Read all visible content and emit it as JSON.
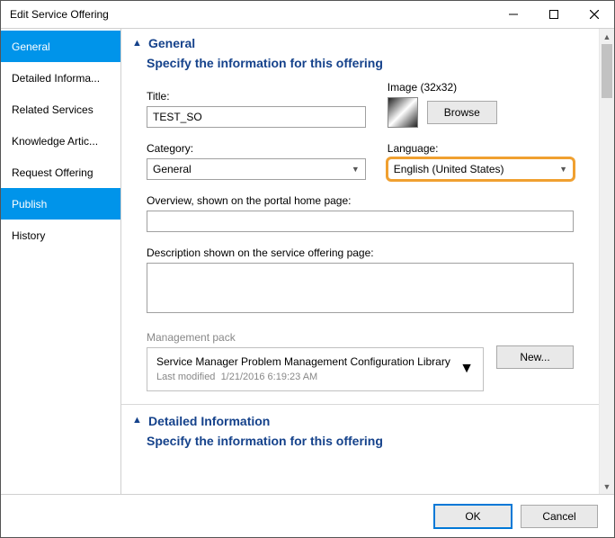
{
  "window": {
    "title": "Edit Service Offering"
  },
  "sidebar": {
    "items": [
      {
        "label": "General"
      },
      {
        "label": "Detailed Informa..."
      },
      {
        "label": "Related Services"
      },
      {
        "label": "Knowledge Artic..."
      },
      {
        "label": "Request Offering"
      },
      {
        "label": "Publish"
      },
      {
        "label": "History"
      }
    ],
    "selected_indices": [
      0,
      5
    ]
  },
  "section_general": {
    "title": "General",
    "subtitle": "Specify the information for this offering",
    "title_field": {
      "label": "Title:",
      "value": "TEST_SO"
    },
    "image": {
      "label": "Image (32x32)",
      "browse": "Browse"
    },
    "category": {
      "label": "Category:",
      "value": "General"
    },
    "language": {
      "label": "Language:",
      "value": "English (United States)"
    },
    "overview": {
      "label": "Overview, shown on the portal home page:",
      "value": ""
    },
    "description": {
      "label": "Description shown on the service offering page:",
      "value": ""
    },
    "mp": {
      "label": "Management pack",
      "name": "Service Manager Problem Management Configuration Library",
      "modified_prefix": "Last modified",
      "modified": "1/21/2016 6:19:23 AM",
      "new": "New..."
    }
  },
  "section_detailed": {
    "title": "Detailed Information",
    "subtitle": "Specify the information for this offering"
  },
  "footer": {
    "ok": "OK",
    "cancel": "Cancel"
  }
}
